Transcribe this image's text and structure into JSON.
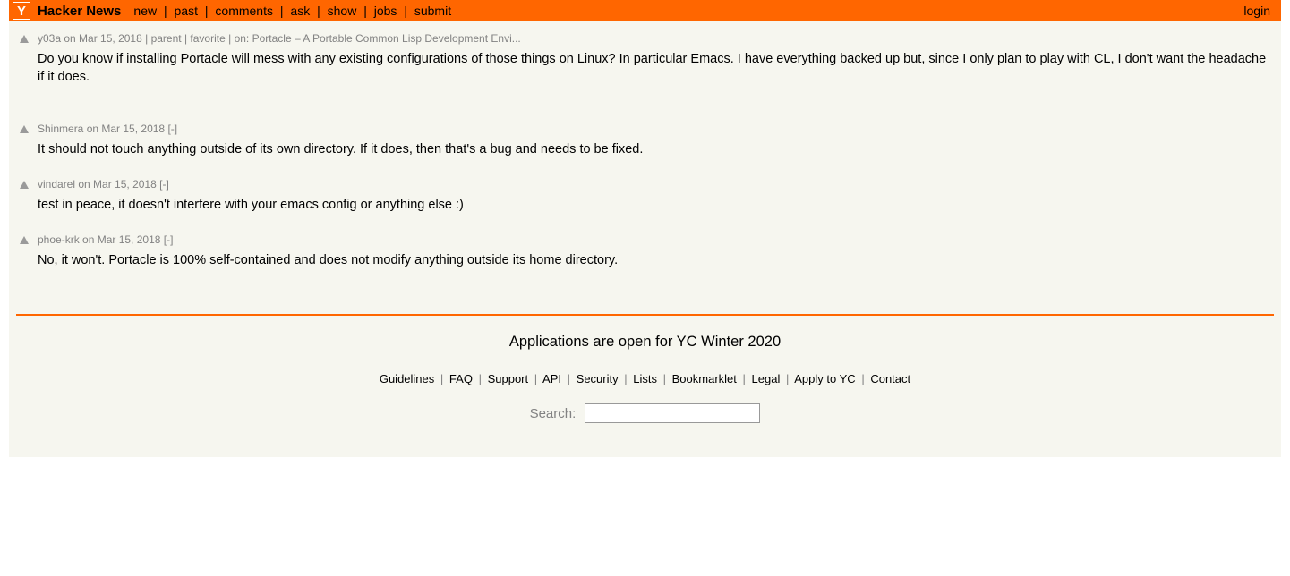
{
  "header": {
    "logo_letter": "Y",
    "site_title": "Hacker News",
    "nav": [
      "new",
      "past",
      "comments",
      "ask",
      "show",
      "jobs",
      "submit"
    ],
    "login": "login"
  },
  "parent_comment": {
    "user": "y03a",
    "age": "on Mar 15, 2018",
    "parent_label": "parent",
    "favorite_label": "favorite",
    "on_label": "on:",
    "story_title": "Portacle – A Portable Common Lisp Development Envi...",
    "text": "Do you know if installing Portacle will mess with any existing configurations of those things on Linux? In particular Emacs. I have everything backed up but, since I only plan to play with CL, I don't want the headache if it does."
  },
  "replies": [
    {
      "user": "Shinmera",
      "age": "on Mar 15, 2018",
      "toggle": "[-]",
      "text": "It should not touch anything outside of its own directory. If it does, then that's a bug and needs to be fixed."
    },
    {
      "user": "vindarel",
      "age": "on Mar 15, 2018",
      "toggle": "[-]",
      "text": "test in peace, it doesn't interfere with your emacs config or anything else :)"
    },
    {
      "user": "phoe-krk",
      "age": "on Mar 15, 2018",
      "toggle": "[-]",
      "text": "No, it won't. Portacle is 100% self-contained and does not modify anything outside its home directory."
    }
  ],
  "footer": {
    "promo": "Applications are open for YC Winter 2020",
    "links": [
      "Guidelines",
      "FAQ",
      "Support",
      "API",
      "Security",
      "Lists",
      "Bookmarklet",
      "Legal",
      "Apply to YC",
      "Contact"
    ],
    "search_label": "Search:"
  }
}
